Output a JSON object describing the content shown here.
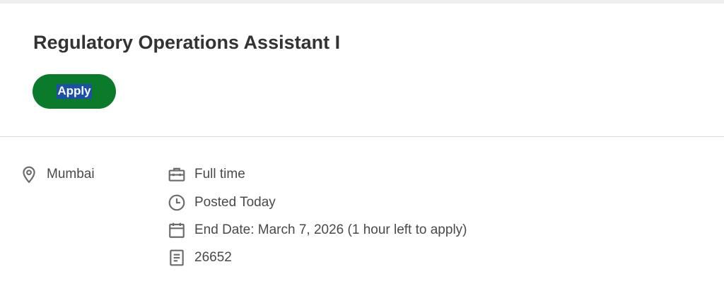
{
  "job": {
    "title": "Regulatory Operations Assistant I",
    "apply_label": "Apply"
  },
  "details": {
    "location": {
      "icon": "location-pin-icon",
      "text": "Mumbai"
    },
    "time_type": {
      "icon": "briefcase-icon",
      "text": "Full time"
    },
    "posted": {
      "icon": "clock-icon",
      "text": "Posted Today"
    },
    "end_date": {
      "icon": "calendar-icon",
      "text": "End Date: March 7, 2026 (1 hour left to apply)"
    },
    "requisition_id": {
      "icon": "document-icon",
      "text": "26652"
    }
  },
  "colors": {
    "apply_button": "#0b7a2b",
    "apply_label_highlight": "#1b4fa8",
    "title_text": "#333333",
    "detail_text": "#494949",
    "icon": "#6b6b6b",
    "divider": "#dadada"
  }
}
